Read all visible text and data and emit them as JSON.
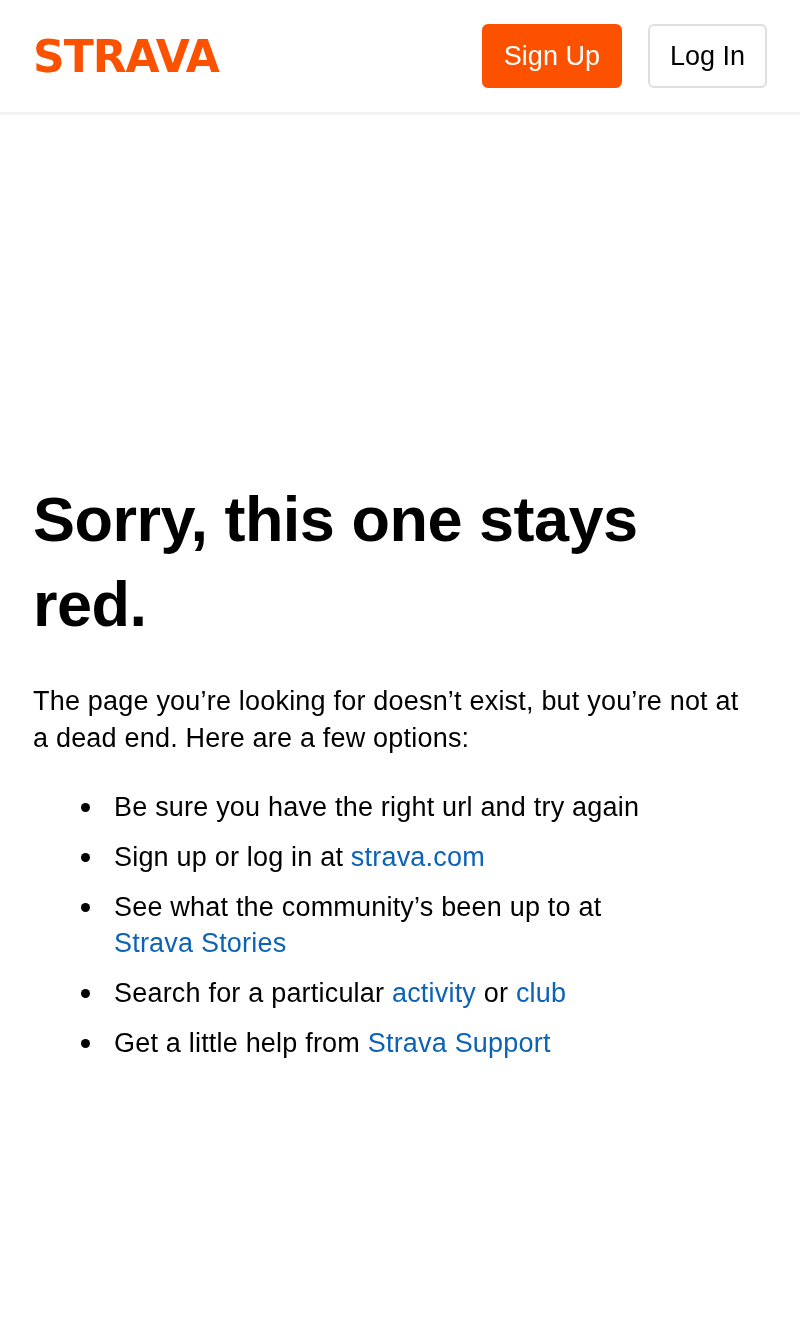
{
  "header": {
    "logo": "STRAVA",
    "buttons": [
      {
        "label": "Sign Up",
        "kind": "primary"
      },
      {
        "label": "Log In",
        "kind": "secondary"
      }
    ]
  },
  "heading": "Sorry, this one stays red.",
  "intro": "The page you’re looking for doesn’t exist, but you’re not at a dead end. Here are a few options:",
  "options": [
    {
      "parts": [
        {
          "kind": "text",
          "text": "Be sure you have the right url and try again"
        }
      ]
    },
    {
      "parts": [
        {
          "kind": "text",
          "text": "Sign up or log in at "
        },
        {
          "kind": "link",
          "text": "strava.com"
        }
      ]
    },
    {
      "parts": [
        {
          "kind": "text",
          "text": "See what the community’s been up to at "
        },
        {
          "kind": "link",
          "text": "Strava Stories"
        }
      ]
    },
    {
      "parts": [
        {
          "kind": "text",
          "text": "Search for a particular "
        },
        {
          "kind": "link",
          "text": "activity"
        },
        {
          "kind": "text",
          "text": " or "
        },
        {
          "kind": "link",
          "text": "club"
        }
      ]
    },
    {
      "parts": [
        {
          "kind": "text",
          "text": "Get a little help from "
        },
        {
          "kind": "link",
          "text": "Strava Support"
        }
      ]
    }
  ]
}
